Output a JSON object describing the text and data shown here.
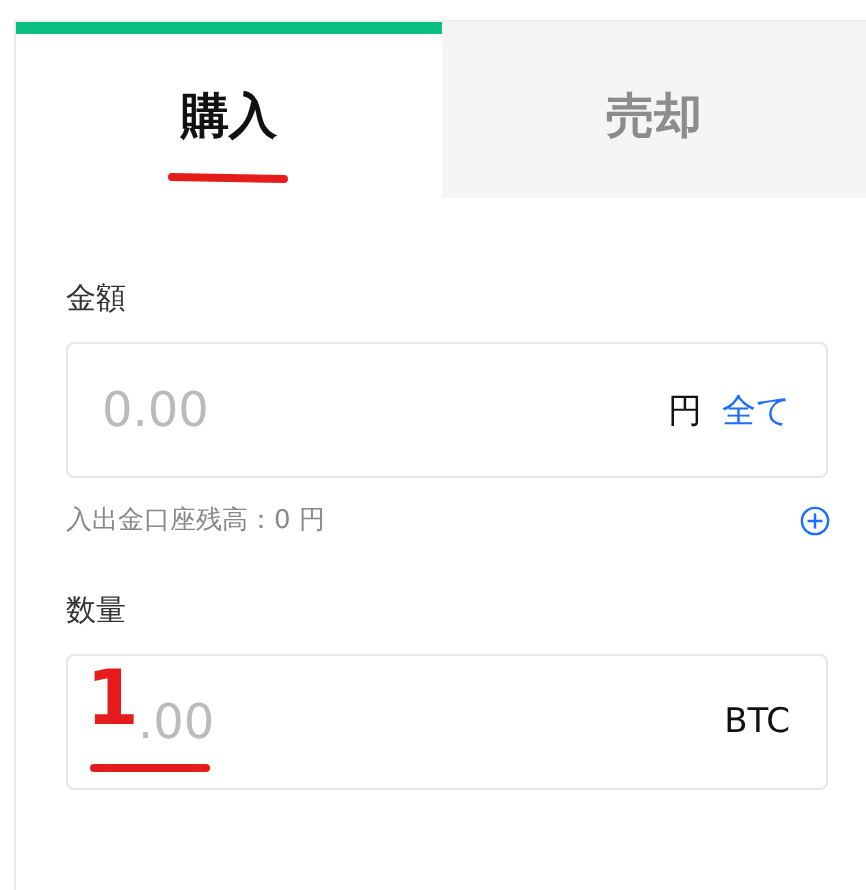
{
  "tabs": [
    {
      "label": "購入",
      "selected": true,
      "annotated": true
    },
    {
      "label": "売却",
      "selected": false,
      "annotated": false
    }
  ],
  "fields": [
    {
      "label": "金額",
      "placeholder": "0.00",
      "unit": "円",
      "action": "全て",
      "note": "入出金口座残高：0 円"
    },
    {
      "label": "数量",
      "placeholder": ".00",
      "unit": "BTC",
      "annotation": {
        "text": "1",
        "underlined": true
      }
    }
  ]
}
